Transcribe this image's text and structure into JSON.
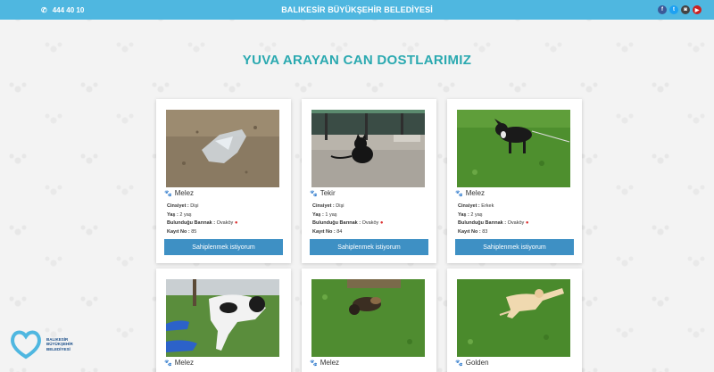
{
  "topbar": {
    "phone": "444 40 10",
    "title": "BALIKESİR BÜYÜKŞEHİR BELEDİYESİ",
    "social": {
      "facebook": "f",
      "twitter": "t",
      "instagram": "◙",
      "youtube": "▶"
    }
  },
  "heading": "YUVA ARAYAN CAN DOSTLARIMIZ",
  "labels": {
    "gender": "Cinsiyet :",
    "age": "Yaş :",
    "shelter": "Bulunduğu Barınak :",
    "record": "Kayıt No :",
    "adopt_button": "Sahiplenmek istiyorum"
  },
  "animals": [
    {
      "breed": "Melez",
      "paw_color": "#e0489a",
      "gender": "Dişi",
      "age": "2 yaş",
      "shelter": "Ovaköy",
      "record_no": "85"
    },
    {
      "breed": "Tekir",
      "paw_color": "#e0489a",
      "gender": "Dişi",
      "age": "1 yaş",
      "shelter": "Ovaköy",
      "record_no": "84"
    },
    {
      "breed": "Melez",
      "paw_color": "#3aa0d8",
      "gender": "Erkek",
      "age": "2 yaş",
      "shelter": "Ovaköy",
      "record_no": "83"
    },
    {
      "breed": "Melez",
      "paw_color": "#e0489a"
    },
    {
      "breed": "Melez",
      "paw_color": "#e0489a"
    },
    {
      "breed": "Golden",
      "paw_color": "#e0489a"
    }
  ],
  "logo": {
    "line1": "BALIKESİR",
    "line2": "BÜYÜKŞEHİR",
    "line3": "BELEDİYESİ"
  },
  "colors": {
    "topbar": "#4fb7e0",
    "heading": "#2aa9b0",
    "button": "#3e90c4"
  }
}
